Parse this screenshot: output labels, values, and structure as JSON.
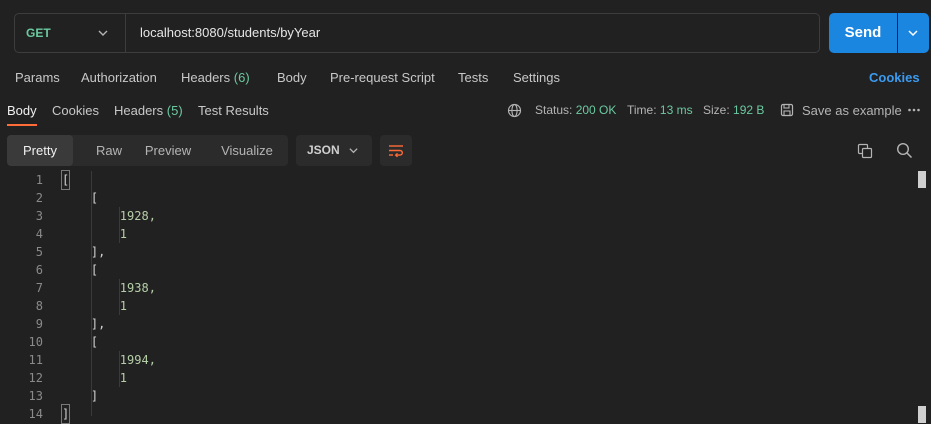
{
  "request": {
    "method": "GET",
    "url": "localhost:8080/students/byYear",
    "send_label": "Send"
  },
  "request_tabs": [
    {
      "label": "Params"
    },
    {
      "label": "Authorization"
    },
    {
      "label": "Headers",
      "count": "(6)"
    },
    {
      "label": "Body"
    },
    {
      "label": "Pre-request Script"
    },
    {
      "label": "Tests"
    },
    {
      "label": "Settings"
    }
  ],
  "cookies_link": "Cookies",
  "response_tabs": [
    {
      "label": "Body"
    },
    {
      "label": "Cookies"
    },
    {
      "label": "Headers",
      "count": "(5)"
    },
    {
      "label": "Test Results"
    }
  ],
  "status": {
    "status_label": "Status:",
    "status_value": "200 OK",
    "time_label": "Time:",
    "time_value": "13 ms",
    "size_label": "Size:",
    "size_value": "192 B",
    "save_label": "Save as example"
  },
  "view_modes": [
    "Pretty",
    "Raw",
    "Preview",
    "Visualize"
  ],
  "format": "JSON",
  "code_lines": [
    {
      "n": "1",
      "text": "["
    },
    {
      "n": "2",
      "text": "    ["
    },
    {
      "n": "3",
      "text": "        1928,"
    },
    {
      "n": "4",
      "text": "        1"
    },
    {
      "n": "5",
      "text": "    ],"
    },
    {
      "n": "6",
      "text": "    ["
    },
    {
      "n": "7",
      "text": "        1938,"
    },
    {
      "n": "8",
      "text": "        1"
    },
    {
      "n": "9",
      "text": "    ],"
    },
    {
      "n": "10",
      "text": "    ["
    },
    {
      "n": "11",
      "text": "        1994,"
    },
    {
      "n": "12",
      "text": "        1"
    },
    {
      "n": "13",
      "text": "    ]"
    },
    {
      "n": "14",
      "text": "]"
    }
  ],
  "colors": {
    "accent": "#1b86e0",
    "method": "#6bc9a0",
    "active_tab_underline": "#ff6c37",
    "link": "#3b9bf0"
  }
}
